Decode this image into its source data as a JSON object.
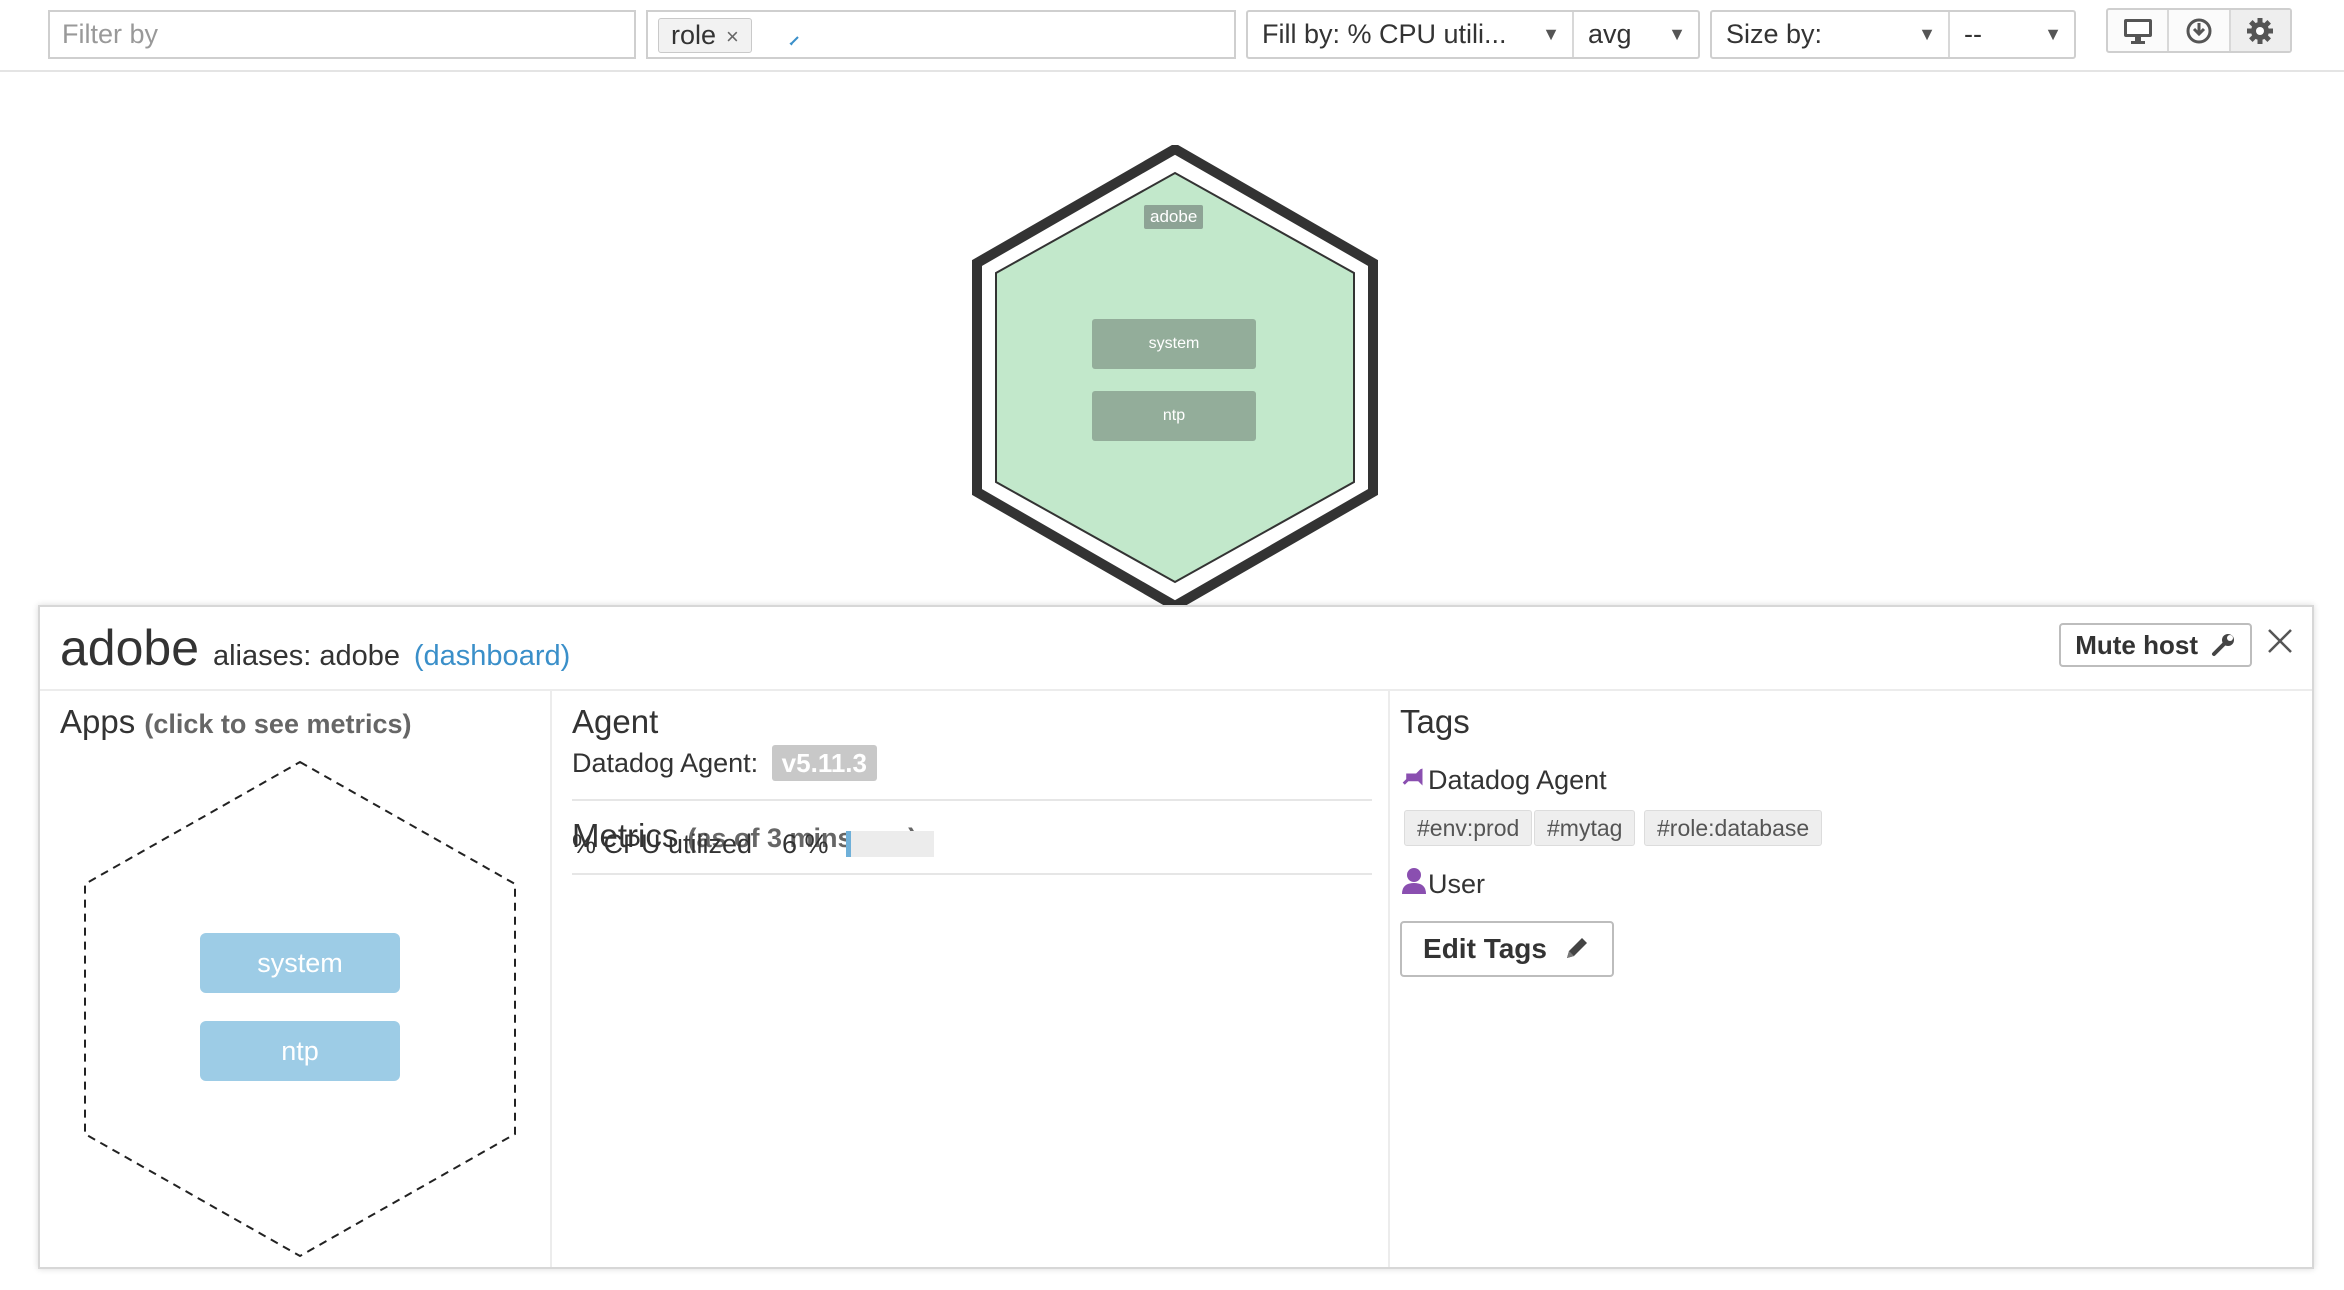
{
  "toolbar": {
    "filter_placeholder": "Filter by",
    "group_tag": "role",
    "group_tag_remove": "×",
    "fill_by_label": "Fill by: % CPU utili...",
    "fill_agg": "avg",
    "size_by_label": "Size by:",
    "size_by_value": "--",
    "arrow": "▼",
    "icons": [
      "monitor-icon",
      "download-icon",
      "gear-icon"
    ]
  },
  "map": {
    "group_label": "adobe",
    "apps": [
      "system",
      "ntp"
    ],
    "host_fill_color": "#c2e8cb",
    "host_border_color": "#333333"
  },
  "panel": {
    "host_name": "adobe",
    "aliases_label": "aliases: adobe",
    "dashboard_link": "(dashboard)",
    "mute_label": "Mute host",
    "apps": {
      "title": "Apps",
      "subtitle": "(click to see metrics)",
      "items": [
        "system",
        "ntp"
      ]
    },
    "agent": {
      "title": "Agent",
      "label": "Datadog Agent:",
      "version": "v5.11.3"
    },
    "metrics": {
      "title": "Metrics",
      "subtitle": "(as of 3 mins ago)",
      "cpu_label": "% CPU utilized",
      "cpu_value": "6 %",
      "cpu_fraction": 0.06
    },
    "tags": {
      "title": "Tags",
      "agent_source": "Datadog Agent",
      "agent_tags": [
        "#env:prod",
        "#mytag",
        "#role:database"
      ],
      "user_source": "User",
      "edit_label": "Edit Tags"
    }
  },
  "colors": {
    "accent": "#3a8fc9",
    "source_icon": "#8a4fb0",
    "app_pill": "#9dcce6",
    "app_pill_map": "#93ad9a"
  }
}
